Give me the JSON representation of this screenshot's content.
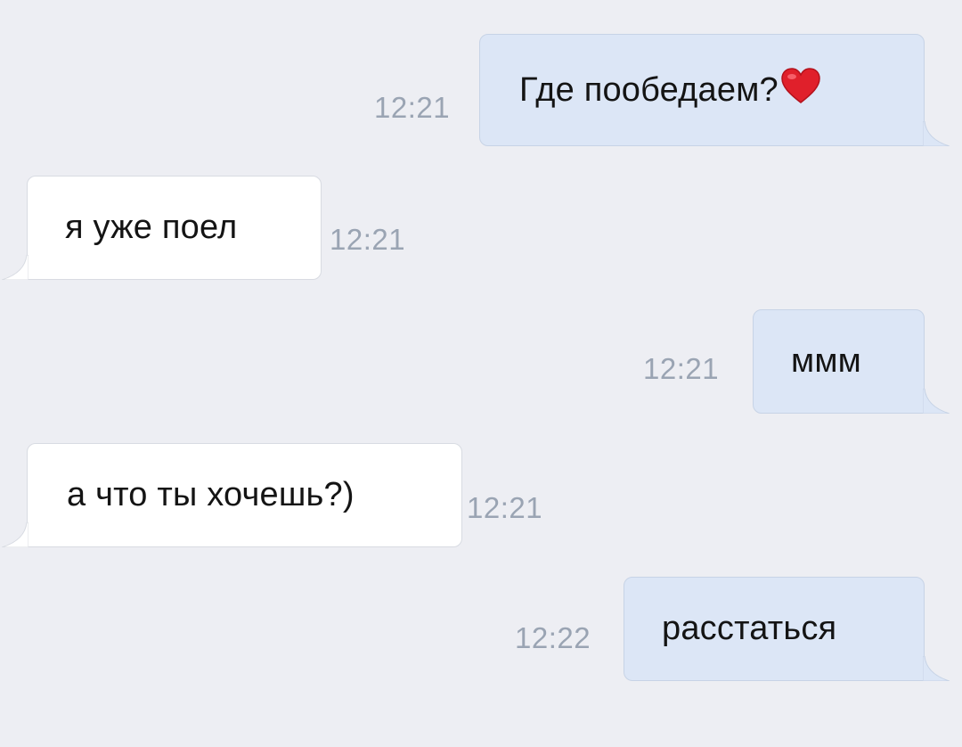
{
  "chat": {
    "messages": [
      {
        "direction": "out",
        "text": "Где пообедаем?",
        "time": "12:21",
        "emoji": "heart-emoji"
      },
      {
        "direction": "in",
        "text": "я уже поел",
        "time": "12:21"
      },
      {
        "direction": "out",
        "text": "ммм",
        "time": "12:21"
      },
      {
        "direction": "in",
        "text": "а что ты хочешь?)",
        "time": "12:21"
      },
      {
        "direction": "out",
        "text": "расстаться",
        "time": "12:22"
      }
    ]
  },
  "colors": {
    "background": "#edeef3",
    "outgoing_bubble": "#dce6f6",
    "incoming_bubble": "#ffffff",
    "timestamp": "#9aa4b3",
    "heart": "#e0202b"
  }
}
